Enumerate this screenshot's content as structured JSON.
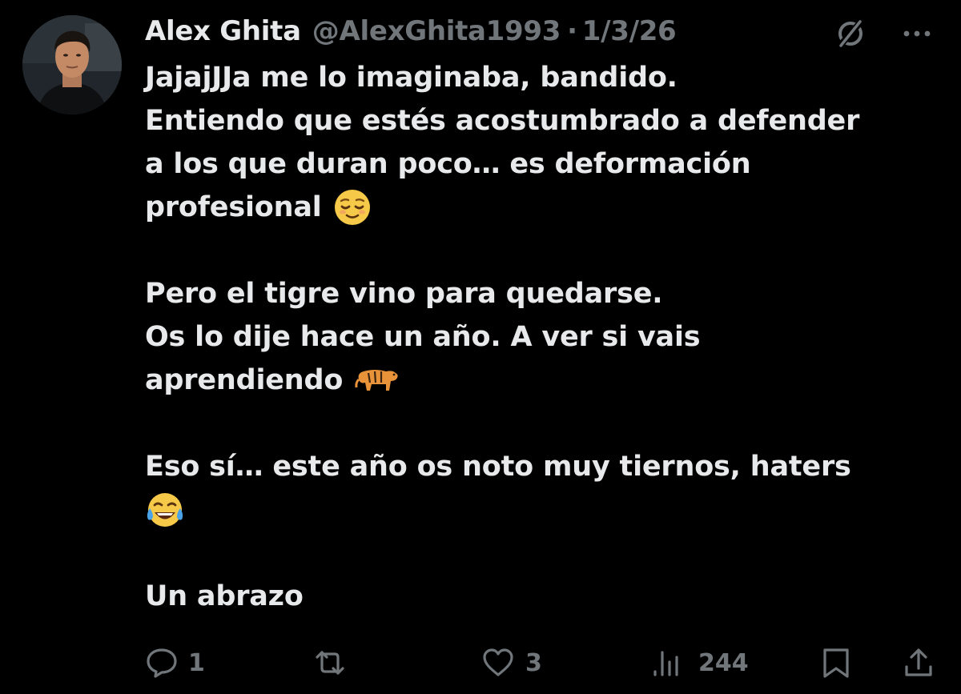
{
  "post": {
    "author": {
      "display_name": "Alex Ghita",
      "handle": "@AlexGhita1993",
      "separator": "·",
      "date": "1/3/26"
    },
    "header_icons": [
      "grok-icon",
      "more-options-icon"
    ],
    "lines": [
      "JajajJJa me lo imaginaba, bandido.",
      "Entiendo que estés acostumbrado a defender",
      "a los que duran poco… es deformación",
      "profesional",
      "Pero el tigre vino para quedarse.",
      "Os lo dije hace un año. A ver si vais",
      "aprendiendo",
      "Eso sí… este año os noto muy tiernos, haters",
      "Un abrazo"
    ],
    "emojis": [
      "relieved-face-emoji",
      "tiger-emoji",
      "tears-of-joy-emoji"
    ],
    "actions": {
      "replies": "1",
      "reposts": "",
      "likes": "3",
      "views": "244"
    }
  },
  "colors": {
    "background": "#000000",
    "primary_text": "#e7e9ea",
    "secondary_text": "#71767b"
  }
}
